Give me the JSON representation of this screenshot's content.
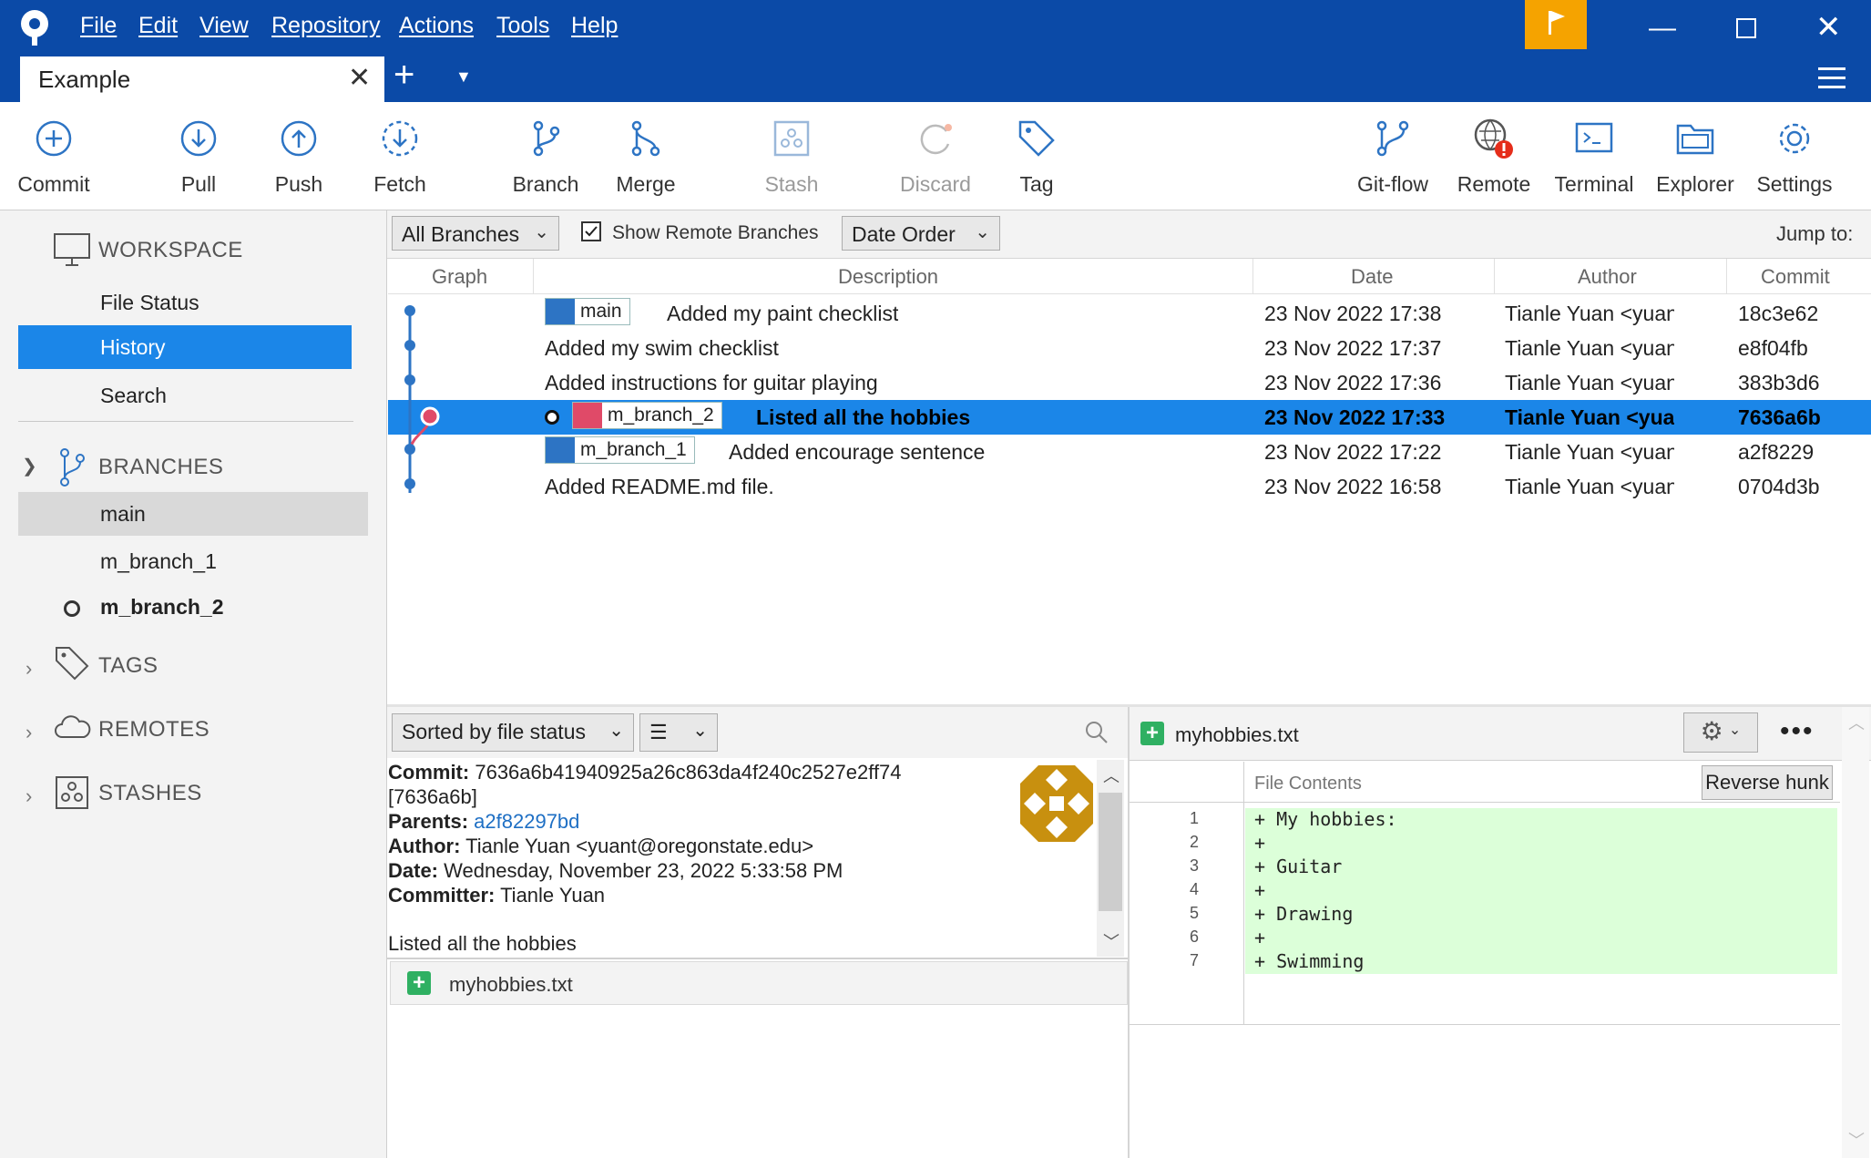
{
  "menu": [
    "File",
    "Edit",
    "View",
    "Repository",
    "Actions",
    "Tools",
    "Help"
  ],
  "tab": {
    "title": "Example"
  },
  "toolbar": {
    "commit": "Commit",
    "pull": "Pull",
    "push": "Push",
    "fetch": "Fetch",
    "branch": "Branch",
    "merge": "Merge",
    "stash": "Stash",
    "discard": "Discard",
    "tag": "Tag",
    "gitflow": "Git-flow",
    "remote": "Remote",
    "terminal": "Terminal",
    "explorer": "Explorer",
    "settings": "Settings"
  },
  "sidebar": {
    "workspace": "WORKSPACE",
    "file_status": "File Status",
    "history": "History",
    "search": "Search",
    "branches": "BRANCHES",
    "branch_items": [
      "main",
      "m_branch_1",
      "m_branch_2"
    ],
    "tags": "TAGS",
    "remotes": "REMOTES",
    "stashes": "STASHES"
  },
  "filter": {
    "branches": "All Branches",
    "show_remote": "Show Remote Branches",
    "order": "Date Order",
    "jump": "Jump to:"
  },
  "columns": {
    "graph": "Graph",
    "description": "Description",
    "date": "Date",
    "author": "Author",
    "commit": "Commit"
  },
  "commits": [
    {
      "tag": "main",
      "desc": "Added my paint checklist",
      "date": "23 Nov 2022 17:38",
      "author": "Tianle Yuan <yuant@o",
      "hash": "18c3e62"
    },
    {
      "desc": "Added my swim checklist",
      "date": "23 Nov 2022 17:37",
      "author": "Tianle Yuan <yuant@o",
      "hash": "e8f04fb"
    },
    {
      "desc": "Added instructions for guitar playing",
      "date": "23 Nov 2022 17:36",
      "author": "Tianle Yuan <yuant@o",
      "hash": "383b3d6"
    },
    {
      "tag": "m_branch_2",
      "desc": "Listed all the hobbies",
      "date": "23 Nov 2022 17:33",
      "author": "Tianle Yuan <yuant@",
      "hash": "7636a6b"
    },
    {
      "tag": "m_branch_1",
      "desc": "Added encourage sentence",
      "date": "23 Nov 2022 17:22",
      "author": "Tianle Yuan <yuant@o",
      "hash": "a2f8229"
    },
    {
      "desc": "Added README.md file.",
      "date": "23 Nov 2022 16:58",
      "author": "Tianle Yuan <yuant@o",
      "hash": "0704d3b"
    }
  ],
  "details": {
    "sort": "Sorted by file status",
    "commit_label": "Commit:",
    "commit_value": "7636a6b41940925a26c863da4f240c2527e2ff74",
    "commit_short": "[7636a6b]",
    "parents_label": "Parents:",
    "parents_value": "a2f82297bd",
    "author_label": "Author:",
    "author_value": "Tianle Yuan <yuant@oregonstate.edu>",
    "date_label": "Date:",
    "date_value": "Wednesday, November 23, 2022 5:33:58 PM",
    "committer_label": "Committer:",
    "committer_value": "Tianle Yuan",
    "message": "Listed all the hobbies",
    "file": "myhobbies.txt"
  },
  "diff": {
    "filename": "myhobbies.txt",
    "contents_label": "File Contents",
    "reverse_hunk": "Reverse hunk",
    "lines": [
      {
        "n": "1",
        "text": "+ My hobbies:"
      },
      {
        "n": "2",
        "text": "+"
      },
      {
        "n": "3",
        "text": "+ Guitar"
      },
      {
        "n": "4",
        "text": "+"
      },
      {
        "n": "5",
        "text": "+ Drawing"
      },
      {
        "n": "6",
        "text": "+"
      },
      {
        "n": "7",
        "text": "+ Swimming"
      }
    ]
  },
  "colors": {
    "accent": "#0b4aa7",
    "selection": "#1b86e8",
    "branch_red": "#e04a68",
    "added": "#dcffd9",
    "flag": "#f5a300"
  }
}
